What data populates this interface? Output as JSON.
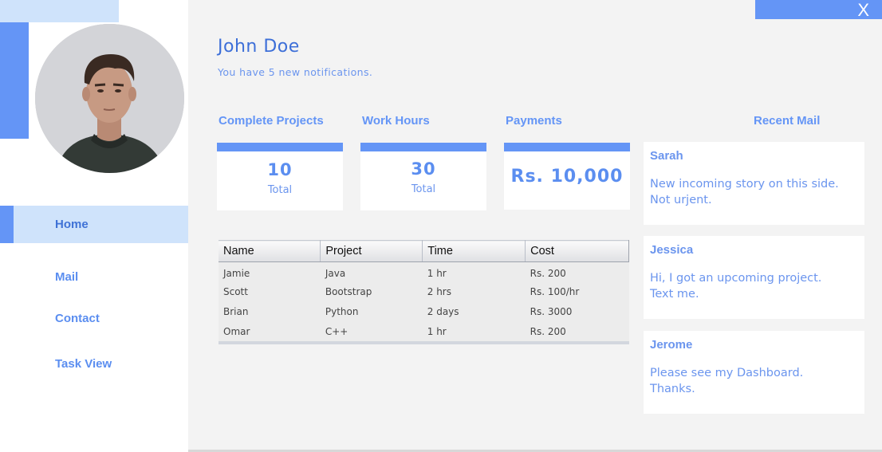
{
  "window": {
    "close_label": "X"
  },
  "user": {
    "name": "John Doe",
    "notification": "You have 5 new notifications."
  },
  "sidebar": {
    "items": [
      {
        "label": "Home",
        "active": true
      },
      {
        "label": "Mail"
      },
      {
        "label": "Contact"
      },
      {
        "label": "Task View"
      }
    ]
  },
  "stats": [
    {
      "title": "Complete Projects",
      "value": "10",
      "sub": "Total"
    },
    {
      "title": "Work Hours",
      "value": "30",
      "sub": "Total"
    },
    {
      "title": "Payments",
      "value": "Rs. 10,000",
      "sub": ""
    }
  ],
  "table": {
    "headers": [
      "Name",
      "Project",
      "Time",
      "Cost"
    ],
    "rows": [
      [
        "Jamie",
        "Java",
        "1 hr",
        "Rs. 200"
      ],
      [
        "Scott",
        "Bootstrap",
        "2 hrs",
        "Rs. 100/hr"
      ],
      [
        "Brian",
        "Python",
        "2 days",
        "Rs. 3000"
      ],
      [
        "Omar",
        "C++",
        "1 hr",
        "Rs. 200"
      ]
    ]
  },
  "mail": {
    "title": "Recent Mail",
    "items": [
      {
        "sender": "Sarah",
        "line1": "New incoming story on this side.",
        "line2": "Not urjent."
      },
      {
        "sender": "Jessica",
        "line1": "Hi, I got an upcoming project.",
        "line2": "Text me."
      },
      {
        "sender": "Jerome",
        "line1": "Please see my Dashboard.",
        "line2": "Thanks."
      }
    ]
  },
  "colors": {
    "accent": "#6495f6",
    "accent_light": "#cfe3fb",
    "text_blue": "#3d6fd8",
    "panel_bg": "#f3f3f3"
  }
}
